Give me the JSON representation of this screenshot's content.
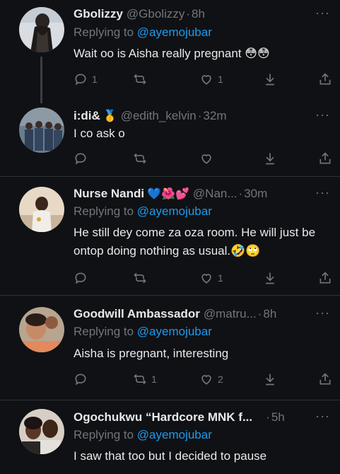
{
  "tweets": [
    {
      "name": "Gbolizzy",
      "handle": "@Gbolizzy",
      "dot": "·",
      "time": "8h",
      "replying_label": "Replying to",
      "replying_to": "@ayemojubar",
      "text": "Wait oo is Aisha really pregnant 😳😳",
      "counts": {
        "reply": "1",
        "retweet": "",
        "like": "1"
      }
    },
    {
      "name": "i:di&",
      "name_emoji": "🥇",
      "handle": "@edith_kelvin",
      "dot": "·",
      "time": "32m",
      "text": "I co ask o",
      "counts": {
        "reply": "",
        "retweet": "",
        "like": ""
      }
    },
    {
      "name": "Nurse Nandi",
      "name_emoji": "💙🌺💕",
      "handle": "@Nan...",
      "dot": "·",
      "time": "30m",
      "replying_label": "Replying to",
      "replying_to": "@ayemojubar",
      "text": "He still dey come za oza room. He will just be ontop doing nothing as usual.🤣🙄",
      "counts": {
        "reply": "",
        "retweet": "",
        "like": "1"
      }
    },
    {
      "name": "Goodwill Ambassador",
      "handle": "@matru...",
      "dot": "·",
      "time": "8h",
      "replying_label": "Replying to",
      "replying_to": "@ayemojubar",
      "text": "Aisha is pregnant, interesting",
      "counts": {
        "reply": "",
        "retweet": "1",
        "like": "2"
      }
    },
    {
      "name": "Ogochukwu “Hardcore MNK f...",
      "handle": "",
      "dot": "·",
      "time": "5h",
      "replying_label": "Replying to",
      "replying_to": "@ayemojubar",
      "text": "I saw that too but I decided to pause"
    }
  ],
  "more_glyph": "···",
  "icons": [
    "reply-icon",
    "retweet-icon",
    "like-icon",
    "download-icon",
    "share-icon",
    "more-icon"
  ],
  "colors": {
    "background": "#101114",
    "text": "#e7e9ea",
    "muted": "#71767b",
    "mention": "#1d9bf0",
    "divider": "#2f3336"
  }
}
